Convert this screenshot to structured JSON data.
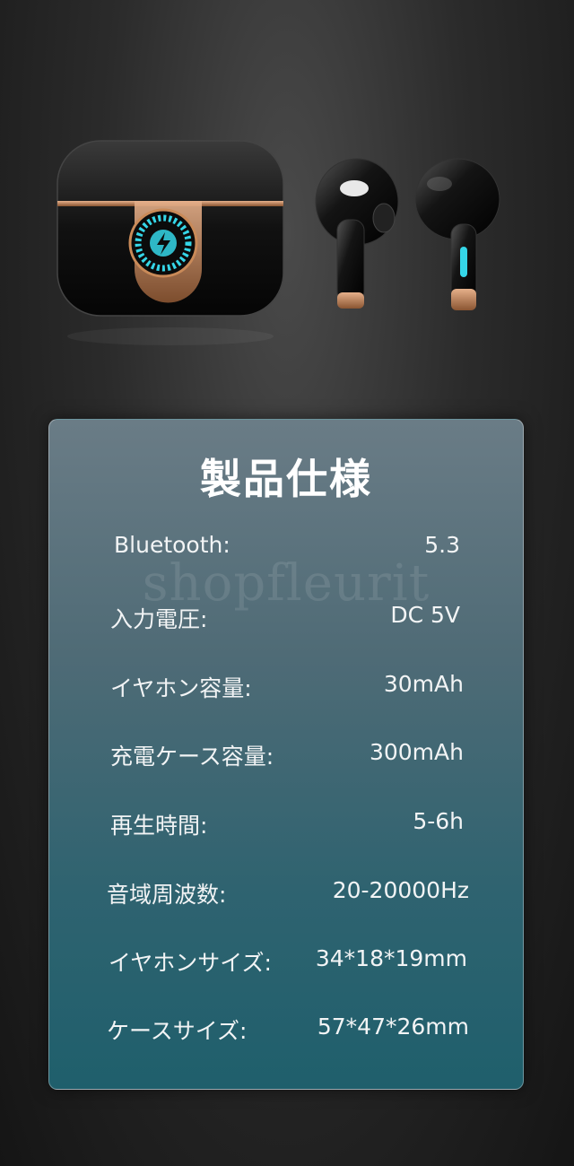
{
  "specs": {
    "title": "製品仕様",
    "watermark": "shopfleurit",
    "rows": [
      {
        "label": "Bluetooth:",
        "value": "5.3"
      },
      {
        "label": "入力電圧:",
        "value": "DC 5V"
      },
      {
        "label": "イヤホン容量:",
        "value": "30mAh"
      },
      {
        "label": "充電ケース容量:",
        "value": "300mAh"
      },
      {
        "label": "再生時間:",
        "value": "5-6h"
      },
      {
        "label": "音域周波数:",
        "value": "20-20000Hz"
      },
      {
        "label": "イヤホンサイズ:",
        "value": "34*18*19mm"
      },
      {
        "label": "ケースサイズ:",
        "value": "57*47*26mm"
      }
    ]
  },
  "colors": {
    "accent_copper": "#c98a58",
    "led_cyan": "#35d6e8",
    "card_top": "#6a7c86",
    "card_bottom": "#1f5f6c"
  }
}
